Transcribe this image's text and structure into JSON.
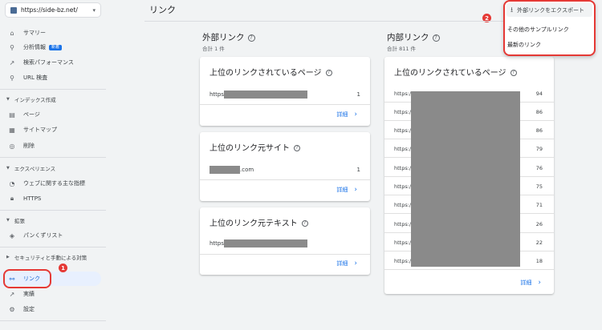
{
  "property": {
    "url": "https://side-bz.net/"
  },
  "sidebar": {
    "items": [
      {
        "label": "サマリー",
        "icon": "home-icon"
      },
      {
        "label": "分析情報",
        "icon": "location-icon",
        "badge": "新着"
      },
      {
        "label": "検索パフォーマンス",
        "icon": "trending-icon"
      },
      {
        "label": "URL 検査",
        "icon": "search-icon"
      }
    ],
    "sections": [
      {
        "label": "インデックス作成",
        "items": [
          {
            "label": "ページ",
            "icon": "pages-icon"
          },
          {
            "label": "サイトマップ",
            "icon": "sitemap-icon"
          },
          {
            "label": "削除",
            "icon": "hidden-icon"
          }
        ]
      },
      {
        "label": "エクスペリエンス",
        "items": [
          {
            "label": "ウェブに関する主な指標",
            "icon": "speed-icon"
          },
          {
            "label": "HTTPS",
            "icon": "lock-icon"
          }
        ]
      },
      {
        "label": "拡張",
        "items": [
          {
            "label": "パンくずリスト",
            "icon": "layers-icon"
          }
        ]
      },
      {
        "label": "セキュリティと手動による対策",
        "items": []
      }
    ],
    "bottom": [
      {
        "label": "リンク",
        "icon": "links-icon",
        "active": true
      },
      {
        "label": "実績",
        "icon": "achievement-icon"
      },
      {
        "label": "設定",
        "icon": "settings-icon"
      }
    ]
  },
  "annotations": {
    "one": "1",
    "two": "2"
  },
  "main": {
    "title": "リンク",
    "external": {
      "title": "外部リンク",
      "subtitle": "合計 1 件",
      "cards": [
        {
          "title": "上位のリンクされているページ",
          "rows": [
            {
              "prefix": "https",
              "suffix": "",
              "value": "1"
            }
          ],
          "detail": "詳細"
        },
        {
          "title": "上位のリンク元サイト",
          "rows": [
            {
              "prefix": "",
              "suffix": ".com",
              "value": "1"
            }
          ],
          "detail": "詳細"
        },
        {
          "title": "上位のリンク元テキスト",
          "rows": [
            {
              "prefix": "https",
              "suffix": "",
              "value": ""
            }
          ],
          "detail": "詳細"
        }
      ]
    },
    "internal": {
      "title": "内部リンク",
      "subtitle": "合計 811 件",
      "card": {
        "title": "上位のリンクされているページ",
        "rows": [
          {
            "prefix": "https://",
            "value": "94"
          },
          {
            "prefix": "https://",
            "value": "86"
          },
          {
            "prefix": "https://",
            "value": "86"
          },
          {
            "prefix": "https://",
            "value": "79"
          },
          {
            "prefix": "https://",
            "value": "76"
          },
          {
            "prefix": "https://",
            "value": "75"
          },
          {
            "prefix": "https://",
            "value": "71"
          },
          {
            "prefix": "https://",
            "value": "26"
          },
          {
            "prefix": "https://",
            "value": "22"
          },
          {
            "prefix": "https://",
            "value": "18"
          }
        ],
        "detail": "詳細"
      }
    }
  },
  "export_menu": {
    "header": "外部リンクをエクスポート",
    "items": [
      "その他のサンプルリンク",
      "最新のリンク"
    ]
  }
}
